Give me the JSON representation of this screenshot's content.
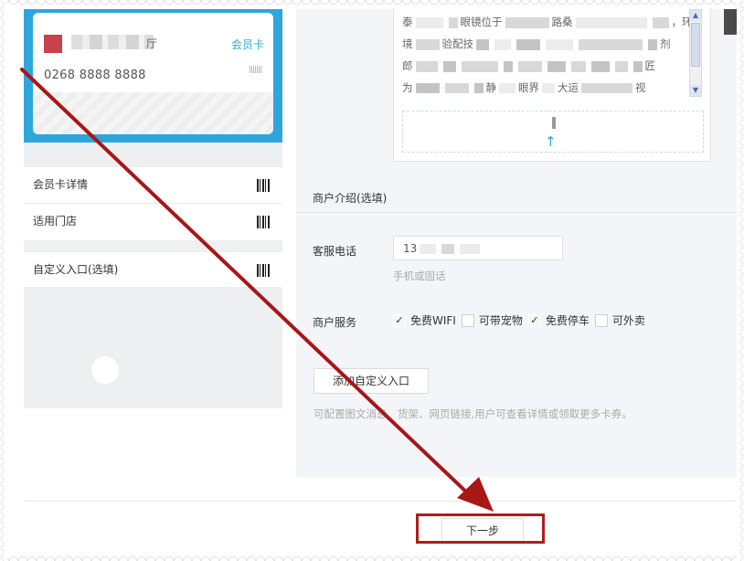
{
  "card": {
    "merchant_suffix": "厅",
    "type_label": "会员卡",
    "number": "0268 8888 8888"
  },
  "preview_list": {
    "items": [
      {
        "label": "会员卡详情"
      },
      {
        "label": "适用门店"
      }
    ],
    "custom_entry": {
      "label": "自定义入口(选填)"
    }
  },
  "address": {
    "line1_start": "泰",
    "line1_mid": "眼镜位于",
    "line1_mid2": "路桑",
    "line1_end": "，环",
    "line2_start": "境",
    "line2_mid": "验配技",
    "line2_end": "剂",
    "line3_start": "郎",
    "line3_end": "匠",
    "line4_start": "为",
    "line4_mid": "静",
    "line4_mid2": "眼界",
    "line4_mid3": "大运",
    "line4_end": "视"
  },
  "form": {
    "intro_title": "商户介绍(选填)",
    "phone_label": "客服电话",
    "phone_value_prefix": "13",
    "phone_hint": "手机或固话",
    "services_label": "商户服务",
    "services": [
      {
        "label": "免费WIFI",
        "checked": true
      },
      {
        "label": "可带宠物",
        "checked": false
      },
      {
        "label": "免费停车",
        "checked": true
      },
      {
        "label": "可外卖",
        "checked": false
      }
    ],
    "add_custom_button": "添加自定义入口",
    "custom_hint": "可配置图文消息、货架、网页链接,用户可查看详情或领取更多卡券。"
  },
  "footer": {
    "next_button": "下一步"
  },
  "colors": {
    "accent_blue": "#2ea6dc",
    "logo_red": "#c9414a",
    "annotation_red": "#b01c1c"
  }
}
